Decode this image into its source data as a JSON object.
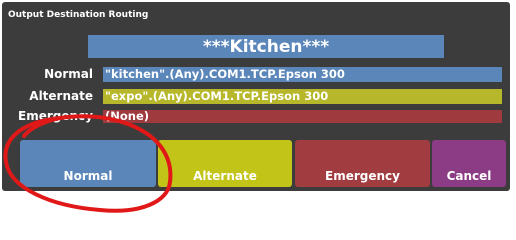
{
  "dialog": {
    "title": "Output Destination Routing",
    "destination": "***Kitchen***"
  },
  "routes": [
    {
      "label": "Normal",
      "value": "\"kitchen\".(Any).COM1.TCP.Epson 300",
      "color": "#5b86b9"
    },
    {
      "label": "Alternate",
      "value": "\"expo\".(Any).COM1.TCP.Epson 300",
      "color": "#b6b72a"
    },
    {
      "label": "Emergency",
      "value": "(None)",
      "color": "#9f3a3f"
    }
  ],
  "buttons": {
    "normal": {
      "label": "Normal",
      "color": "#5b86b9"
    },
    "alternate": {
      "label": "Alternate",
      "color": "#c2c418"
    },
    "emergency": {
      "label": "Emergency",
      "color": "#a13d40"
    },
    "cancel": {
      "label": "Cancel",
      "color": "#8c3b85"
    }
  },
  "annotation": {
    "color": "#e01818"
  }
}
